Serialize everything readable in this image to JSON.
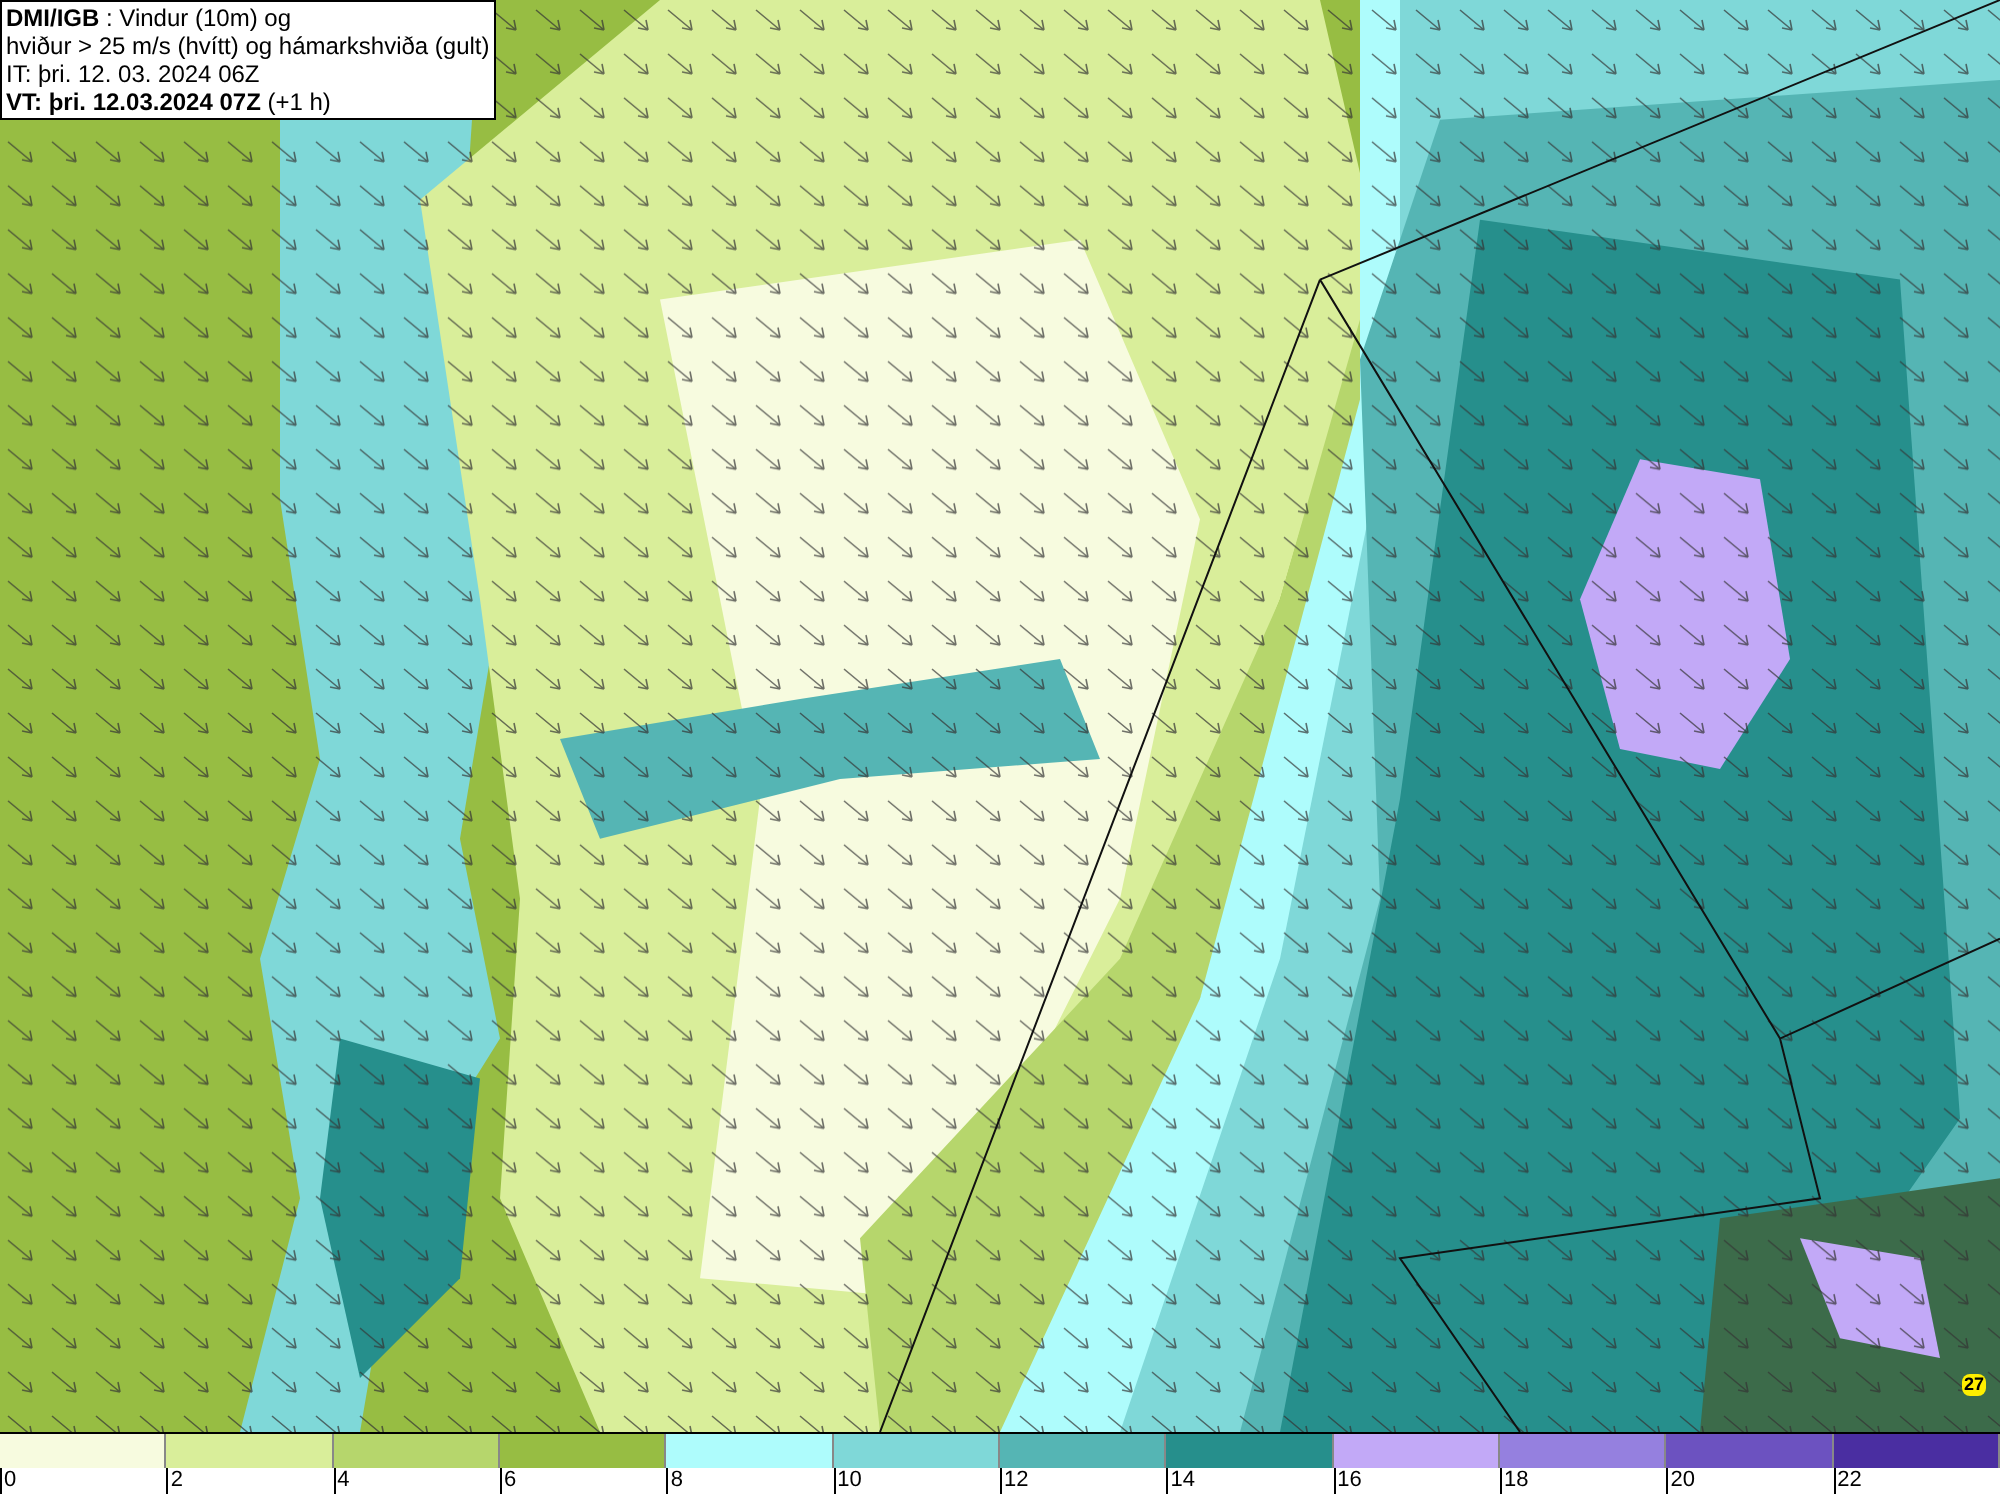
{
  "title_box": {
    "lines": [
      "**DMI/IGB** : Vindur (10m) og",
      "hviður > 25 m/s (hvítt) og hámarkshviða (gult)",
      "IT: þri. 12. 03. 2024 06Z",
      "**VT: þri. 12.03.2024 07Z** (+1 h)"
    ]
  },
  "map": {
    "gust_label": "27"
  },
  "legend": [
    {
      "label": "0",
      "color": "#f7fbdf"
    },
    {
      "label": "2",
      "color": "#d9ee9a"
    },
    {
      "label": "4",
      "color": "#b6d66c"
    },
    {
      "label": "6",
      "color": "#97bd43"
    },
    {
      "label": "8",
      "color": "#aefcfc"
    },
    {
      "label": "10",
      "color": "#7fd8d8"
    },
    {
      "label": "12",
      "color": "#55b5b4"
    },
    {
      "label": "14",
      "color": "#268f8c"
    },
    {
      "label": "16",
      "color": "#c2a9f7"
    },
    {
      "label": "18",
      "color": "#9580df"
    },
    {
      "label": "20",
      "color": "#6c52c0"
    },
    {
      "label": "22",
      "color": "#4a2ea1"
    }
  ]
}
